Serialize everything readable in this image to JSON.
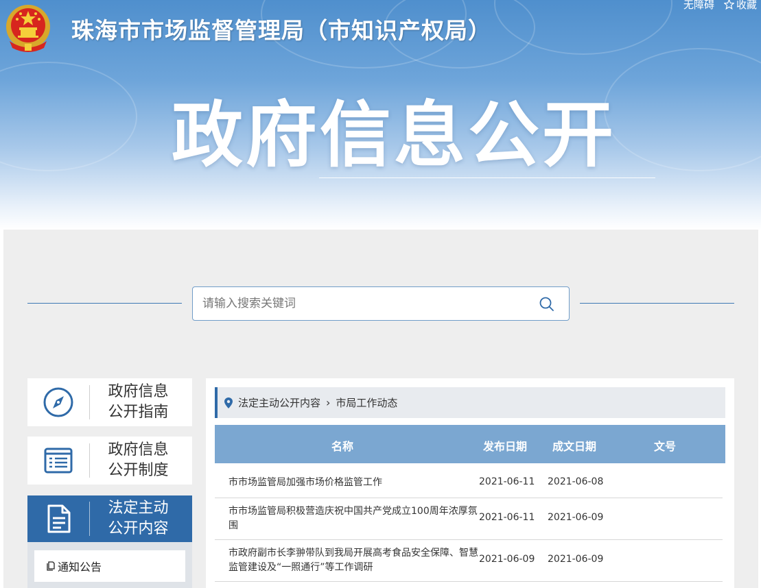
{
  "header": {
    "site_title": "珠海市市场监督管理局（市知识产权局）",
    "accessibility_link": "无障碍",
    "favorite_link": "收藏",
    "banner_title": "政府信息公开"
  },
  "search": {
    "placeholder": "请输入搜索关键词"
  },
  "sidebar": {
    "items": [
      {
        "line1": "政府信息",
        "line2": "公开指南",
        "icon": "compass-icon"
      },
      {
        "line1": "政府信息",
        "line2": "公开制度",
        "icon": "document-list-icon"
      },
      {
        "line1": "法定主动",
        "line2": "公开内容",
        "icon": "document-icon",
        "active": true
      }
    ],
    "sub_items": [
      {
        "label": "通知公告"
      }
    ]
  },
  "breadcrumb": {
    "level1": "法定主动公开内容",
    "level2": "市局工作动态"
  },
  "table": {
    "headers": {
      "name": "名称",
      "publish_date": "发布日期",
      "doc_date": "成文日期",
      "doc_no": "文号"
    },
    "rows": [
      {
        "name": "市市场监管局加强市场价格监管工作",
        "publish_date": "2021-06-11",
        "doc_date": "2021-06-08"
      },
      {
        "name": "市市场监管局积极营造庆祝中国共产党成立100周年浓厚氛围",
        "publish_date": "2021-06-11",
        "doc_date": "2021-06-09"
      },
      {
        "name": "市政府副市长李翀带队到我局开展高考食品安全保障、智慧监管建设及“一照通行”等工作调研",
        "publish_date": "2021-06-09",
        "doc_date": "2021-06-09"
      }
    ]
  },
  "colors": {
    "primary": "#2f6aa8",
    "table_header": "#7ba7d1",
    "banner_top": "#4f8fcd"
  }
}
